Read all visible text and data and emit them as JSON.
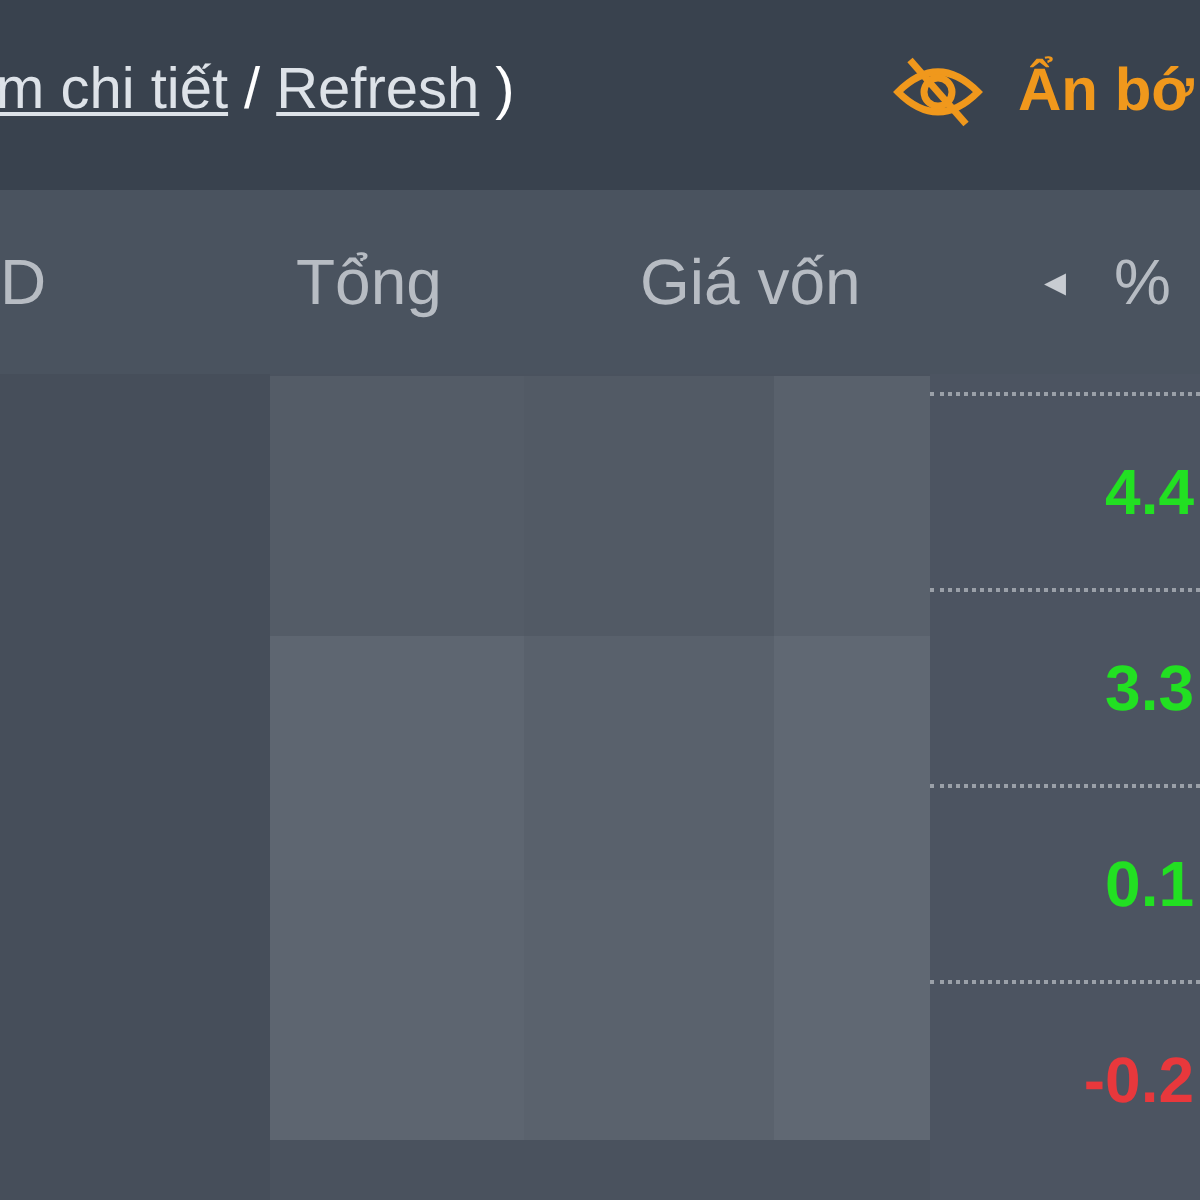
{
  "top_bar": {
    "parts": [
      {
        "kind": "link",
        "text": "m chi tiết"
      },
      {
        "kind": "text",
        "text": "/"
      },
      {
        "kind": "link",
        "text": "Refresh"
      },
      {
        "kind": "text",
        "text": ")"
      }
    ],
    "hide_button": {
      "label": "Ẩn bớ"
    }
  },
  "table": {
    "columns": [
      {
        "label": "D"
      },
      {
        "label": "Tổng"
      },
      {
        "label": "Giá vốn"
      },
      {
        "label": "%",
        "arrow": "◂"
      }
    ],
    "rows": [
      {
        "change": "4.4",
        "color": "#22e022"
      },
      {
        "change": "3.3",
        "color": "#22e022"
      },
      {
        "change": "0.1",
        "color": "#22e022"
      },
      {
        "change": "-0.2",
        "color": "#e8383c"
      }
    ]
  }
}
